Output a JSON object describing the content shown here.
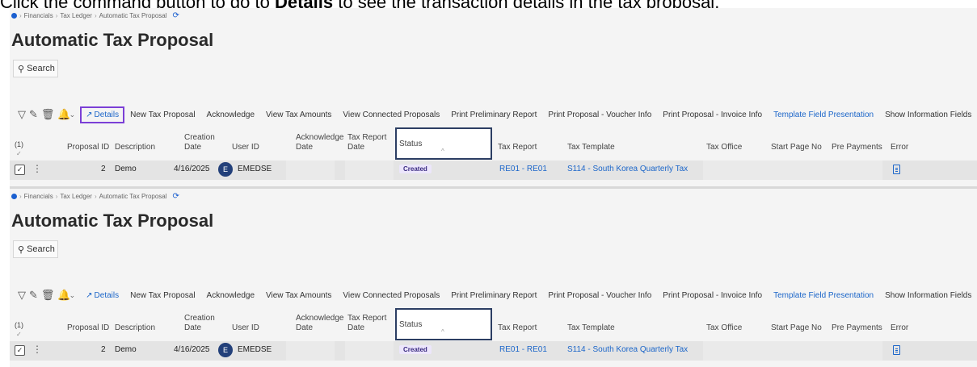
{
  "instruction": {
    "pre": "Click the command button to go to ",
    "bold": "Details",
    "post": " to see the transaction details in the tax proposal."
  },
  "breadcrumb": [
    "Financials",
    "Tax Ledger",
    "Automatic Tax Proposal"
  ],
  "page_title": "Automatic Tax Proposal",
  "search_label": "Search",
  "toolbar": {
    "details": "Details",
    "new_tax_proposal": "New Tax Proposal",
    "acknowledge": "Acknowledge",
    "view_tax_amounts": "View Tax Amounts",
    "view_connected_proposals": "View Connected Proposals",
    "print_preliminary_report": "Print Preliminary Report",
    "print_proposal_voucher": "Print Proposal - Voucher Info",
    "print_proposal_invoice": "Print Proposal - Invoice Info",
    "template_field_presentation": "Template Field Presentation",
    "show_information_fields": "Show Information Fields"
  },
  "selection_count": "(1)",
  "columns": {
    "proposal_id": "Proposal ID",
    "description": "Description",
    "creation_date_1": "Creation",
    "creation_date_2": "Date",
    "user_id": "User ID",
    "acknowledge_date_1": "Acknowledge",
    "acknowledge_date_2": "Date",
    "tax_report_date_1": "Tax Report",
    "tax_report_date_2": "Date",
    "status": "Status",
    "tax_report": "Tax Report",
    "tax_template": "Tax Template",
    "tax_office": "Tax Office",
    "start_page_no": "Start Page No",
    "pre_payments": "Pre Payments",
    "error": "Error"
  },
  "row": {
    "proposal_id": "2",
    "description": "Demo",
    "creation_date": "4/16/2025",
    "user_initial": "E",
    "user_id": "EMEDSE",
    "status": "Created",
    "tax_report": "RE01 - RE01",
    "tax_template": "S114 - South Korea Quarterly Tax"
  },
  "colors": {
    "highlight": "#7b3fd6",
    "link": "#1c66c9",
    "status_border": "#2c3e63",
    "avatar": "#23407a"
  }
}
